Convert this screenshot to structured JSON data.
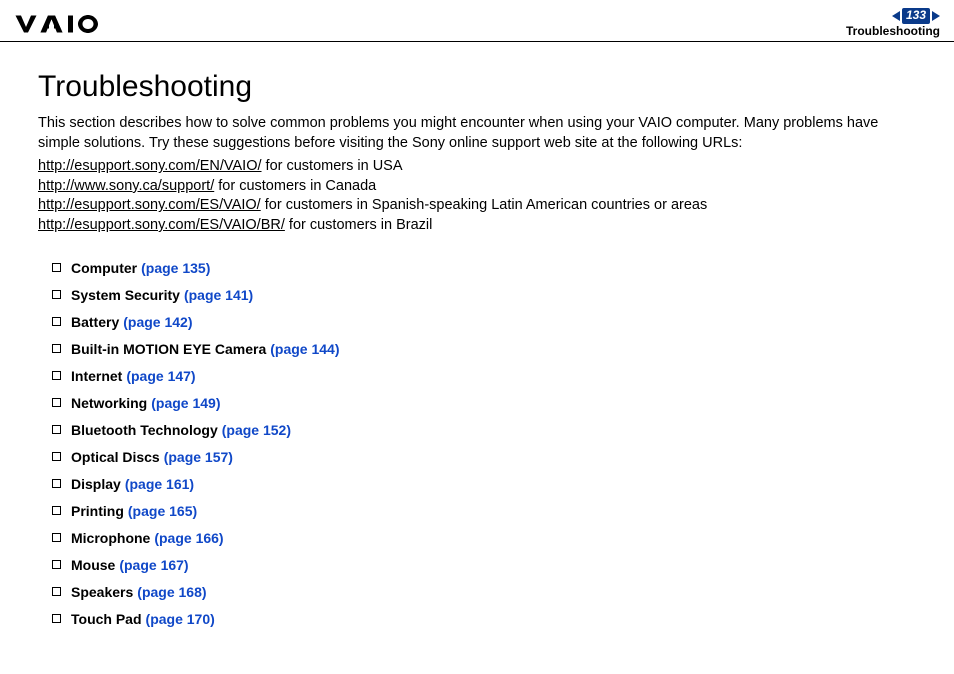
{
  "header": {
    "page_number": "133",
    "section_label": "Troubleshooting"
  },
  "title": "Troubleshooting",
  "intro": "This section describes how to solve common problems you might encounter when using your VAIO computer. Many problems have simple solutions. Try these suggestions before visiting the Sony online support web site at the following URLs:",
  "urls": [
    {
      "href": "http://esupport.sony.com/EN/VAIO/",
      "suffix": " for customers in USA"
    },
    {
      "href": "http://www.sony.ca/support/",
      "suffix": " for customers in Canada"
    },
    {
      "href": "http://esupport.sony.com/ES/VAIO/",
      "suffix": " for customers in Spanish-speaking Latin American countries or areas"
    },
    {
      "href": "http://esupport.sony.com/ES/VAIO/BR/",
      "suffix": " for customers in Brazil"
    }
  ],
  "toc": [
    {
      "label": "Computer",
      "page": "(page 135)"
    },
    {
      "label": "System Security",
      "page": "(page 141)"
    },
    {
      "label": "Battery",
      "page": "(page 142)"
    },
    {
      "label": "Built-in MOTION EYE Camera",
      "page": "(page 144)"
    },
    {
      "label": "Internet",
      "page": "(page 147)"
    },
    {
      "label": "Networking",
      "page": "(page 149)"
    },
    {
      "label": "Bluetooth Technology",
      "page": "(page 152)"
    },
    {
      "label": "Optical Discs",
      "page": "(page 157)"
    },
    {
      "label": "Display",
      "page": "(page 161)"
    },
    {
      "label": "Printing",
      "page": "(page 165)"
    },
    {
      "label": "Microphone",
      "page": "(page 166)"
    },
    {
      "label": "Mouse",
      "page": "(page 167)"
    },
    {
      "label": "Speakers",
      "page": "(page 168)"
    },
    {
      "label": "Touch Pad",
      "page": "(page 170)"
    }
  ]
}
